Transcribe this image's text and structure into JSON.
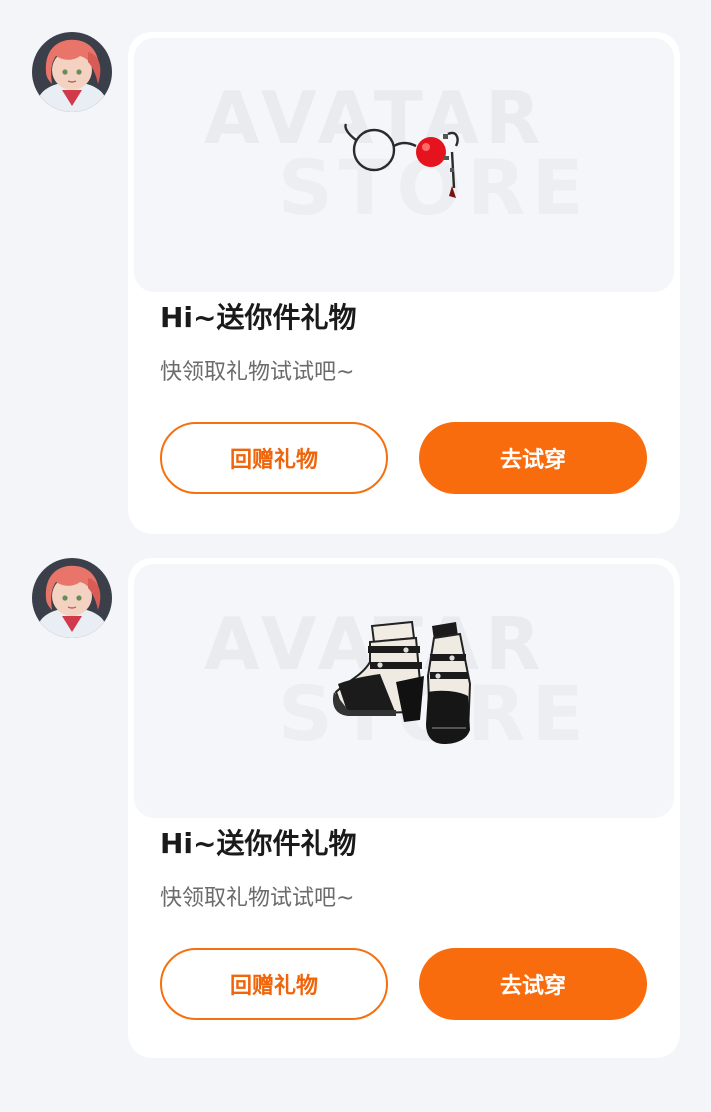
{
  "colors": {
    "accent": "#f96c0e",
    "background": "#f3f5f8",
    "card": "#ffffff"
  },
  "messages": [
    {
      "avatar_icon": "user-avatar",
      "watermark_line1": "AVATAR",
      "watermark_line2": "STORE",
      "item_icon": "glasses-icon",
      "title": "Hi~送你件礼物",
      "subtitle": "快领取礼物试试吧~",
      "return_gift_label": "回赠礼物",
      "try_on_label": "去试穿"
    },
    {
      "avatar_icon": "user-avatar",
      "watermark_line1": "AVATAR",
      "watermark_line2": "STORE",
      "item_icon": "heels-icon",
      "title": "Hi~送你件礼物",
      "subtitle": "快领取礼物试试吧~",
      "return_gift_label": "回赠礼物",
      "try_on_label": "去试穿"
    }
  ]
}
